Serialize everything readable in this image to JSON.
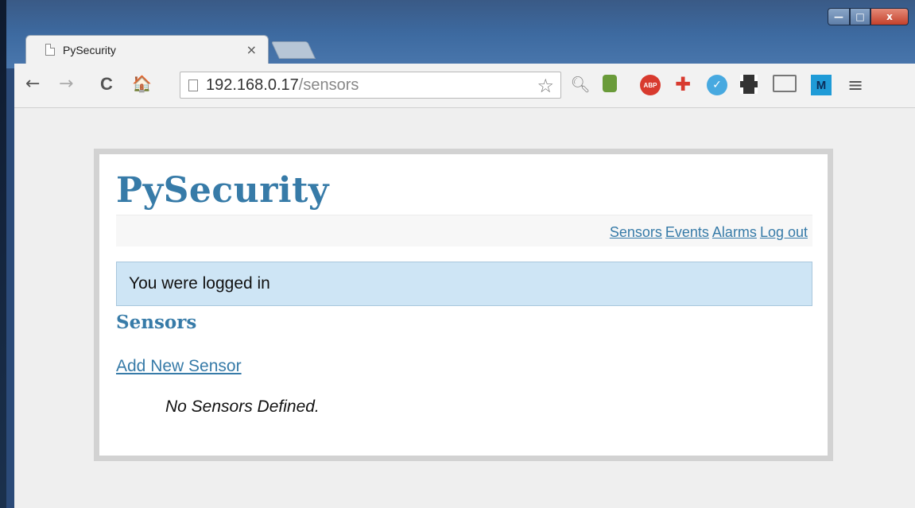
{
  "browser": {
    "tab_title": "PySecurity",
    "tab_close": "×",
    "url_host": "192.168.0.17",
    "url_path": "/sensors",
    "window_controls": {
      "minimize": "—",
      "maximize": "□",
      "close": "x"
    },
    "extensions": [
      "search-icon",
      "evernote-icon",
      "adblock-icon",
      "plus-icon",
      "v-icon",
      "film-icon",
      "cast-icon",
      "m-icon"
    ],
    "abp_label": "ABP",
    "v_label": "✓",
    "m_label": "M",
    "nav": {
      "back": "←",
      "forward": "→",
      "reload": "C",
      "home": "🏠",
      "star": "☆",
      "menu": "≡"
    }
  },
  "page": {
    "site_title": "PySecurity",
    "nav_links": [
      {
        "label": "Sensors"
      },
      {
        "label": "Events"
      },
      {
        "label": "Alarms"
      },
      {
        "label": "Log out"
      }
    ],
    "flash_message": "You were logged in",
    "section_title": "Sensors",
    "add_link": "Add New Sensor",
    "empty_message": "No Sensors Defined."
  },
  "colors": {
    "accent": "#377ba8",
    "flash_bg": "#cee5f5",
    "page_border": "#d2d2d2"
  }
}
